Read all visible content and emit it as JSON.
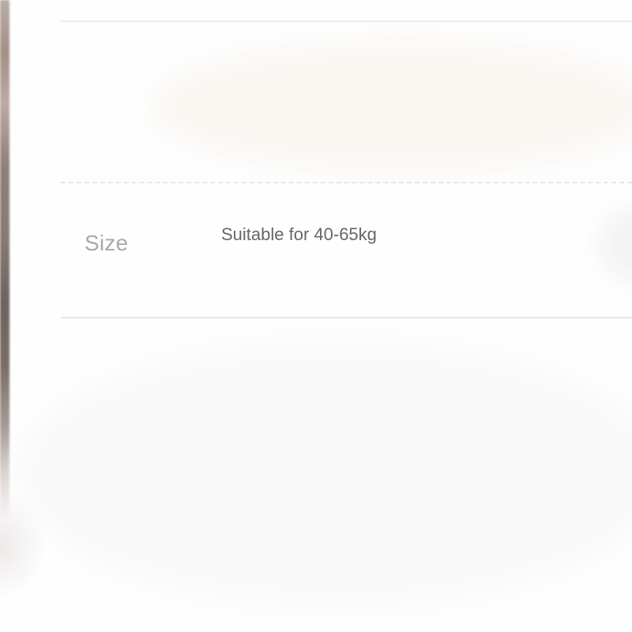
{
  "spec_table": {
    "rows": [
      {
        "label": "Size",
        "value": "Suitable for 40-65kg"
      }
    ]
  },
  "colors": {
    "label_text": "#a8a8a8",
    "value_text": "#6b6565",
    "divider": "#e6e6e6"
  }
}
